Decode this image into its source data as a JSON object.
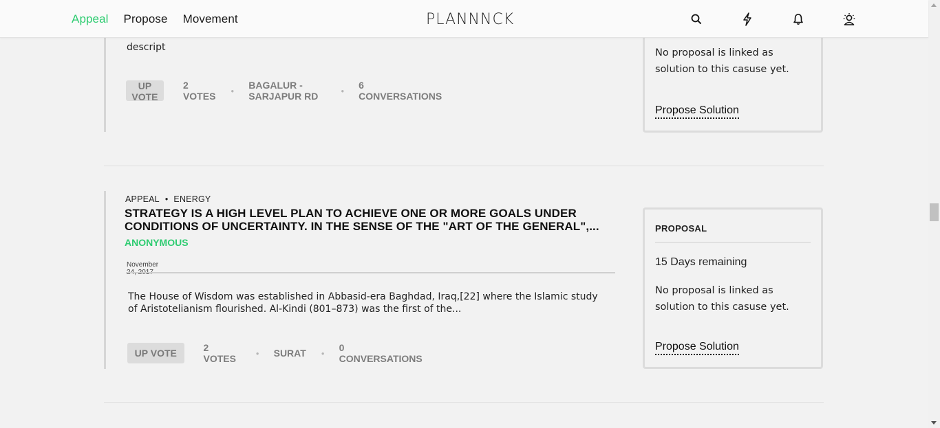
{
  "header": {
    "nav": [
      "Appeal",
      "Propose",
      "Movement"
    ],
    "active_index": 0,
    "logo": "PLANNNCK",
    "icons": [
      "search-icon",
      "lightning-icon",
      "bell-icon",
      "user-icon"
    ]
  },
  "items": [
    {
      "desc": "descript",
      "upvote_label": "UP VOTE",
      "votes": "2 VOTES",
      "location": "BAGALUR - SARJAPUR RD",
      "conversations": "6 CONVERSATIONS",
      "card": {
        "note": "No proposal is linked as solution to this casuse yet.",
        "solution_label": "Propose Solution"
      }
    },
    {
      "type": "APPEAL",
      "category": "ENERGY",
      "title": "STRATEGY IS A HIGH LEVEL PLAN TO ACHIEVE ONE OR MORE GOALS UNDER CONDITIONS OF UNCERTAINTY. IN THE SENSE OF THE \"ART OF THE GENERAL\",...",
      "author": "ANONYMOUS",
      "date": "November 24, 2017",
      "desc": "The House of Wisdom was established in Abbasid-era Baghdad, Iraq,[22] where the Islamic study of Aristotelianism flourished. Al-Kindi (801–873) was the first of the...",
      "upvote_label": "UP VOTE",
      "votes": "2 VOTES",
      "location": "SURAT",
      "conversations": "0 CONVERSATIONS",
      "card": {
        "label": "PROPOSAL",
        "days": "15 Days remaining",
        "note": "No proposal is linked as solution to this casuse yet.",
        "solution_label": "Propose Solution"
      }
    }
  ]
}
